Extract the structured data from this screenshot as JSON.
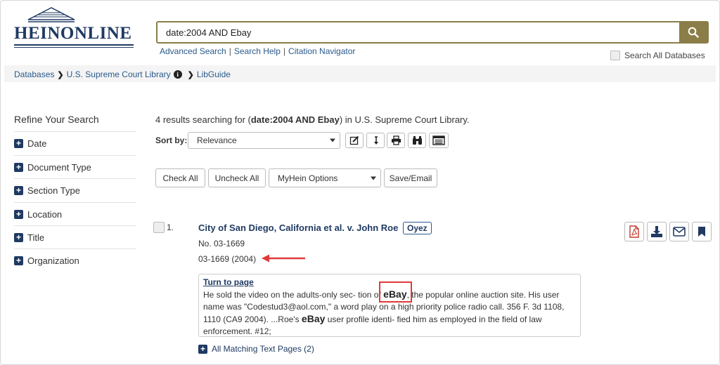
{
  "header": {
    "logo_text": "HEINONLINE",
    "search_value": "date:2004 AND Ebay",
    "links": [
      "Advanced Search",
      "Search Help",
      "Citation Navigator"
    ],
    "search_all_label": "Search All Databases"
  },
  "breadcrumb": [
    "Databases",
    "U.S. Supreme Court Library",
    "LibGuide"
  ],
  "sidebar": {
    "title": "Refine Your Search",
    "facets": [
      "Date",
      "Document Type",
      "Section Type",
      "Location",
      "Title",
      "Organization"
    ]
  },
  "results": {
    "count_text": "4 results searching for (",
    "query": "date:2004 AND Ebay",
    "suffix": ") in U.S. Supreme Court Library.",
    "sort_label": "Sort by:",
    "sort_value": "Relevance",
    "check_all": "Check All",
    "uncheck_all": "Uncheck All",
    "myhein": "MyHein Options",
    "save_email": "Save/Email"
  },
  "result1": {
    "number": "1.",
    "title": "City of San Diego, California et al. v. John Roe",
    "badge": "Oyez",
    "docket": "No. 03-1669",
    "citation": "03-1669 (2004)",
    "turn_to_page": "Turn to page",
    "snippet_a": "He sold the video on the adults-only sec- tion of ",
    "highlight1": "eBay",
    "snippet_b": ", the popular online auction site. His user name was \"Codestud3@aol.com,\" a word play on a high priority police radio call. 356 F. 3d 1108, 1110 (CA9 2004). ...Roe's ",
    "highlight2": "eBay",
    "snippet_c": " user profile identi- fied him as employed in the field of law enforcement. #12;",
    "all_matching": "All Matching Text Pages (2)"
  },
  "colors": {
    "brand_navy": "#1f3a63",
    "search_gold": "#8a7d48",
    "pdf_red": "#c0392b",
    "annotation_red": "#e03a3a"
  }
}
